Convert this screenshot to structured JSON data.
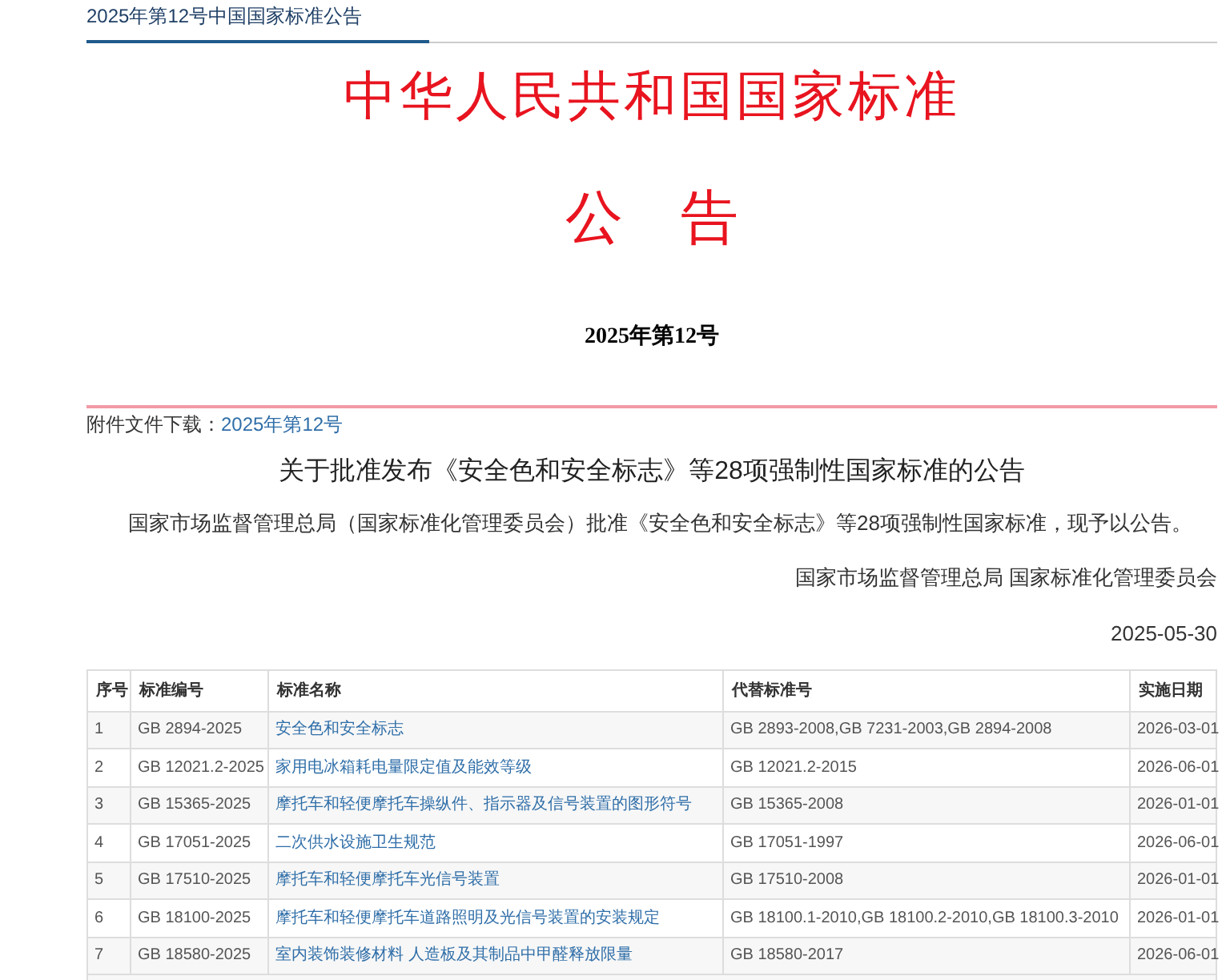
{
  "breadcrumb": "2025年第12号中国国家标准公告",
  "header": {
    "title": "中华人民共和国国家标准",
    "subtitle": "公　告",
    "issue": "2025年第12号"
  },
  "attachment": {
    "label": "附件文件下载：",
    "link": "2025年第12号"
  },
  "notice": {
    "heading": "关于批准发布《安全色和安全标志》等28项强制性国家标准的公告",
    "body": "国家市场监督管理总局（国家标准化管理委员会）批准《安全色和安全标志》等28项强制性国家标准，现予以公告。",
    "signature": "国家市场监督管理总局 国家标准化管理委员会",
    "date": "2025-05-30"
  },
  "table": {
    "columns": [
      "序号",
      "标准编号",
      "标准名称",
      "代替标准号",
      "实施日期"
    ],
    "rows": [
      [
        "1",
        "GB 2894-2025",
        "安全色和安全标志",
        "GB 2893-2008,GB 7231-2003,GB 2894-2008",
        "2026-03-01"
      ],
      [
        "2",
        "GB 12021.2-2025",
        "家用电冰箱耗电量限定值及能效等级",
        "GB 12021.2-2015",
        "2026-06-01"
      ],
      [
        "3",
        "GB 15365-2025",
        "摩托车和轻便摩托车操纵件、指示器及信号装置的图形符号",
        "GB 15365-2008",
        "2026-01-01"
      ],
      [
        "4",
        "GB 17051-2025",
        "二次供水设施卫生规范",
        "GB 17051-1997",
        "2026-06-01"
      ],
      [
        "5",
        "GB 17510-2025",
        "摩托车和轻便摩托车光信号装置",
        "GB 17510-2008",
        "2026-01-01"
      ],
      [
        "6",
        "GB 18100-2025",
        "摩托车和轻便摩托车道路照明及光信号装置的安装规定",
        "GB 18100.1-2010,GB 18100.2-2010,GB 18100.3-2010",
        "2026-01-01"
      ],
      [
        "7",
        "GB 18580-2025",
        "室内装饰装修材料 人造板及其制品中甲醛释放限量",
        "GB 18580-2017",
        "2026-06-01"
      ]
    ]
  }
}
